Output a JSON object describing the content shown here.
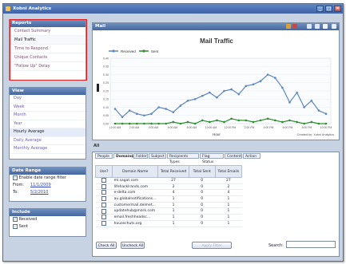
{
  "app": {
    "title": "Xobni Analytics"
  },
  "reports": {
    "header": "Reports",
    "items": [
      {
        "label": "Contact Summary",
        "selected": false
      },
      {
        "label": "Mail Traffic",
        "selected": true
      },
      {
        "label": "Time to Respond",
        "selected": false
      },
      {
        "label": "Unique Contacts",
        "selected": false
      },
      {
        "label": "\"Follow Up\" Delay",
        "selected": false
      }
    ]
  },
  "view": {
    "header": "View",
    "items": [
      {
        "label": "Day",
        "selected": false
      },
      {
        "label": "Week",
        "selected": false
      },
      {
        "label": "Month",
        "selected": false
      },
      {
        "label": "Year",
        "selected": false
      },
      {
        "label": "Hourly Average",
        "selected": true
      },
      {
        "label": "Daily Average",
        "selected": false
      },
      {
        "label": "Monthly Average",
        "selected": false
      }
    ]
  },
  "date_range": {
    "header": "Date Range",
    "enable_label": "Enable date range filter",
    "from_label": "From:",
    "from_value": "11/1/2009",
    "to_label": "To:",
    "to_value": "5/2/2010"
  },
  "include": {
    "header": "Include",
    "received_label": "Received",
    "sent_label": "Sent"
  },
  "chart_panel": {
    "header": "Mail"
  },
  "chart_data": {
    "type": "line",
    "title": "Mail Traffic",
    "xlabel": "Hour",
    "ylabel": "",
    "watermark": "Created by: Xobni Analytics",
    "legend_position": "top-left",
    "grid": true,
    "ylim": [
      0,
      0.4
    ],
    "yticks": [
      "0.00",
      "0.05",
      "0.10",
      "0.15",
      "0.20",
      "0.25",
      "0.30",
      "0.35",
      "0.40"
    ],
    "x_tick_labels": [
      "12:00 AM",
      "2:00 AM",
      "4:00 AM",
      "6:00 AM",
      "8:00 AM",
      "10:00 AM",
      "12:00 PM",
      "2:00 PM",
      "4:00 PM",
      "6:00 PM",
      "8:00 PM",
      "10:00 PM"
    ],
    "series": [
      {
        "name": "Received",
        "color": "#5b86c4",
        "values": [
          0.09,
          0.04,
          0.08,
          0.06,
          0.05,
          0.06,
          0.1,
          0.09,
          0.07,
          0.11,
          0.14,
          0.15,
          0.17,
          0.19,
          0.16,
          0.2,
          0.21,
          0.18,
          0.23,
          0.24,
          0.26,
          0.3,
          0.28,
          0.22,
          0.13,
          0.19,
          0.1,
          0.14,
          0.08,
          0.06
        ]
      },
      {
        "name": "Sent",
        "color": "#2f8f2f",
        "values": [
          0.0,
          0.0,
          0.0,
          0.0,
          0.0,
          0.0,
          0.0,
          0.0,
          0.01,
          0.0,
          0.01,
          0.0,
          0.02,
          0.01,
          0.02,
          0.01,
          0.03,
          0.02,
          0.02,
          0.01,
          0.02,
          0.03,
          0.02,
          0.01,
          0.02,
          0.01,
          0.0,
          0.01,
          0.0,
          0.0
        ]
      }
    ]
  },
  "all_label": "All",
  "tabs": [
    "People",
    "Domains",
    "Folder",
    "Subject",
    "Recipients Types",
    "Flag Status",
    "Content",
    "Action"
  ],
  "active_tab": 1,
  "table": {
    "headers": [
      "Use?",
      "Domain Name",
      "Total Received",
      "Total Sent",
      "Total Emails"
    ],
    "rows": [
      [
        "",
        "ml.sagat.com",
        "27",
        "0",
        "27"
      ],
      [
        "",
        "lifehacklrands.com",
        "2",
        "0",
        "2"
      ],
      [
        "",
        "e-delta.com",
        "4",
        "0",
        "4"
      ],
      [
        "",
        "au.globalnotifications...",
        "1",
        "0",
        "1"
      ],
      [
        "",
        "customermail.delmet...",
        "1",
        "0",
        "1"
      ],
      [
        "",
        "updatehub@mark.com",
        "1",
        "0",
        "1"
      ],
      [
        "",
        "email.freshheadsc...",
        "1",
        "0",
        "1"
      ],
      [
        "",
        "housechuts.org",
        "1",
        "0",
        "1"
      ]
    ]
  },
  "buttons": {
    "check_all": "Check All",
    "uncheck_all": "Uncheck All",
    "apply_filter": "Apply Filter"
  },
  "search": {
    "label": "Search:",
    "value": ""
  },
  "colors": {
    "title_bar": "#4a6fb0",
    "panel_header": "#5a7bb0",
    "highlight_box": "#e02020",
    "received": "#5b86c4",
    "sent": "#2f8f2f"
  }
}
